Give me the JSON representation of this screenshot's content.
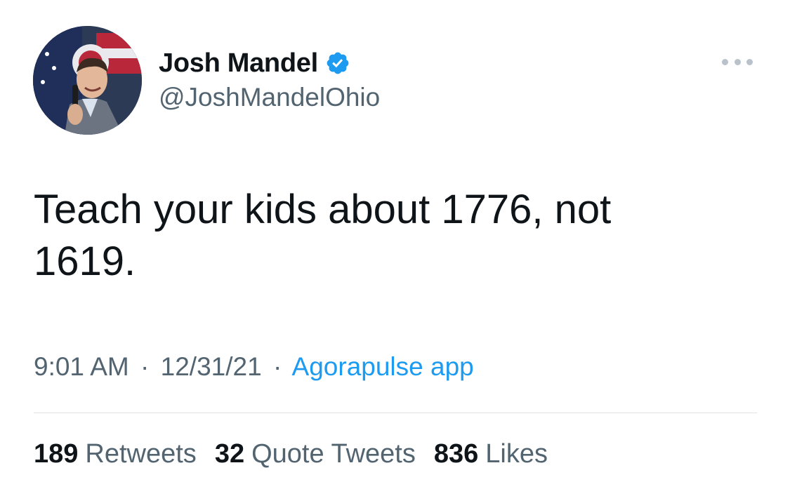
{
  "author": {
    "display_name": "Josh Mandel",
    "handle": "@JoshMandelOhio",
    "verified": true
  },
  "tweet": {
    "text_line1": "Teach your kids about 1776, not",
    "text_line2": "1619."
  },
  "meta": {
    "time": "9:01 AM",
    "separator": "·",
    "date": "12/31/21",
    "source": "Agorapulse app"
  },
  "stats": {
    "retweets_count": "189",
    "retweets_label": "Retweets",
    "quotes_count": "32",
    "quotes_label": "Quote Tweets",
    "likes_count": "836",
    "likes_label": "Likes"
  },
  "icons": {
    "verified": "verified-badge-icon",
    "more": "more-options-icon"
  },
  "colors": {
    "accent": "#1d9bf0",
    "text_primary": "#0f1419",
    "text_secondary": "#536471"
  }
}
